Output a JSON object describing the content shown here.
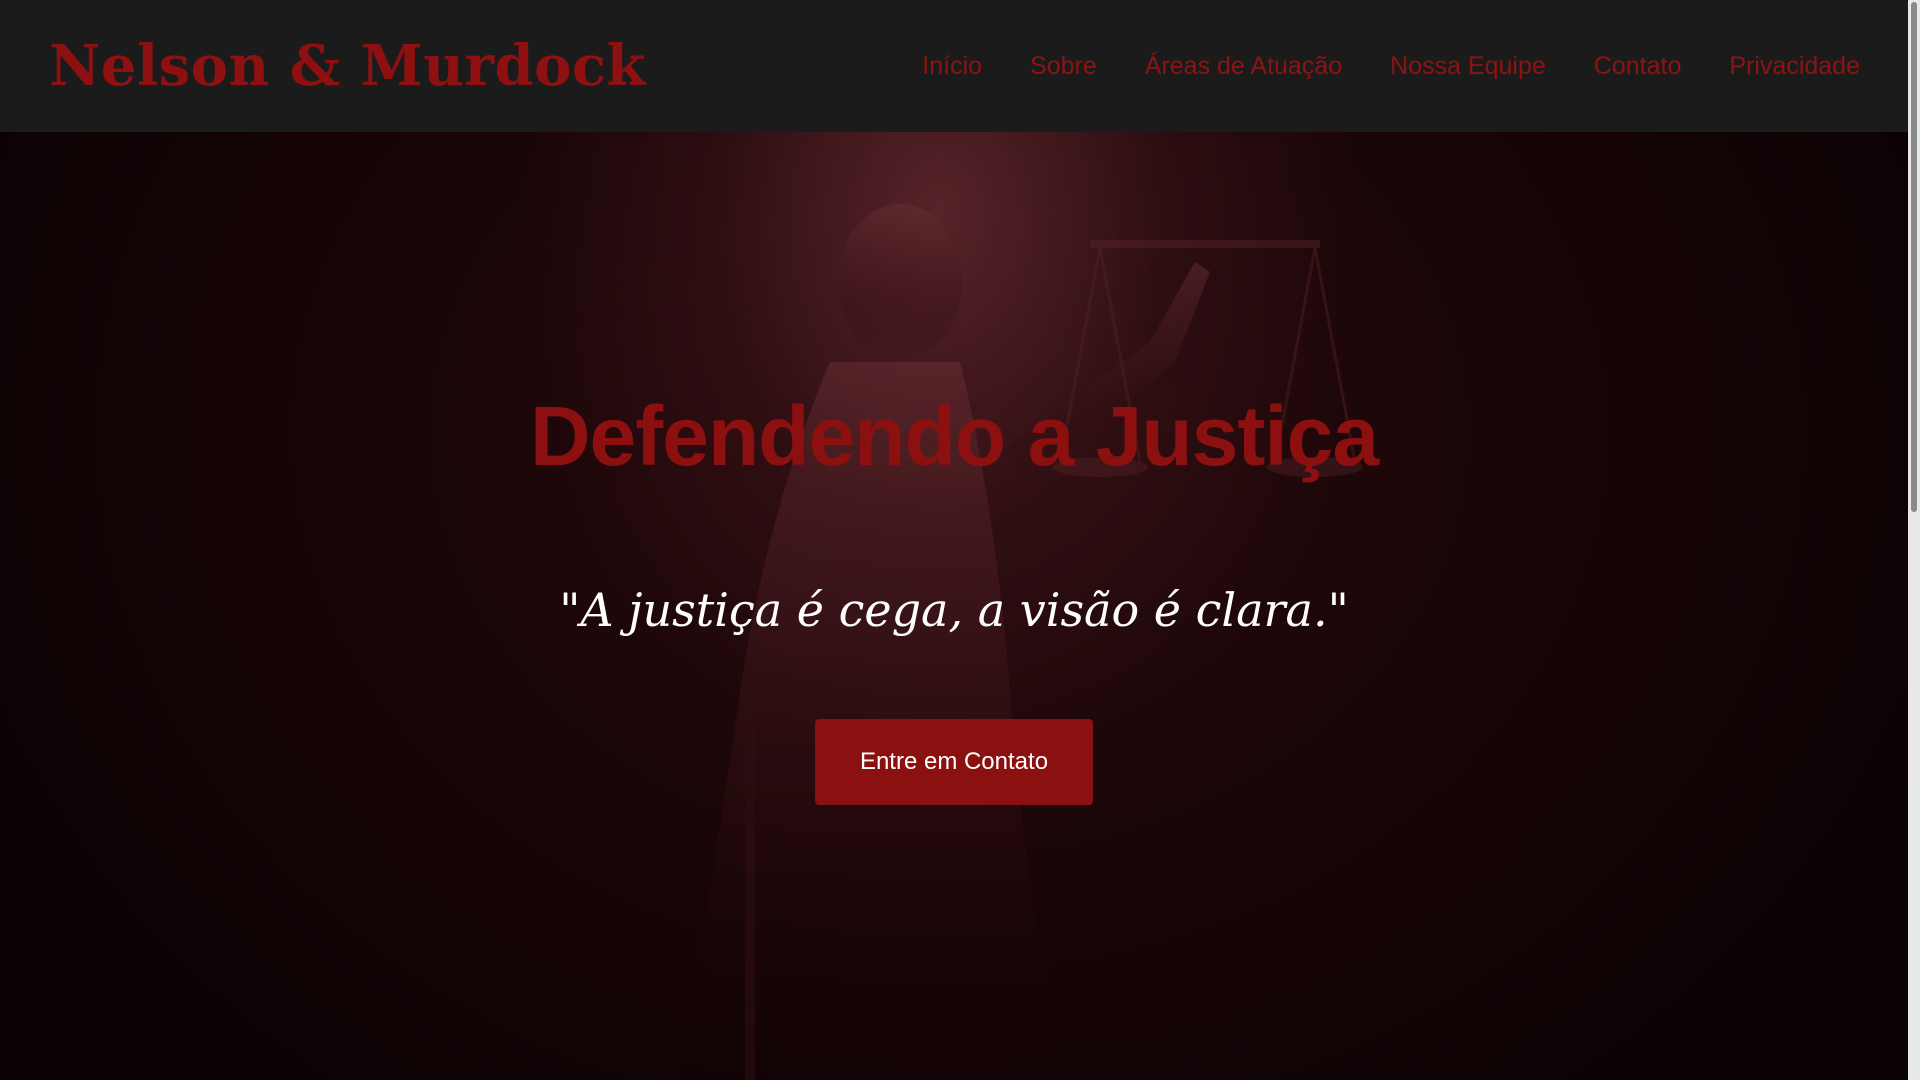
{
  "header": {
    "logo": "Nelson & Murdock",
    "nav": [
      {
        "label": "Início"
      },
      {
        "label": "Sobre"
      },
      {
        "label": "Áreas de Atuação"
      },
      {
        "label": "Nossa Equipe"
      },
      {
        "label": "Contato"
      },
      {
        "label": "Privacidade"
      }
    ]
  },
  "hero": {
    "title": "Defendendo a Justiça",
    "quote": "\"A justiça é cega, a visão é clara.\"",
    "cta_label": "Entre em Contato",
    "background_image": "lady-justice-statue"
  },
  "colors": {
    "accent": "#8b1010",
    "header_bg": "#1b1b1b",
    "hero_bg": "#1a0507",
    "quote_text": "#ffffff"
  }
}
